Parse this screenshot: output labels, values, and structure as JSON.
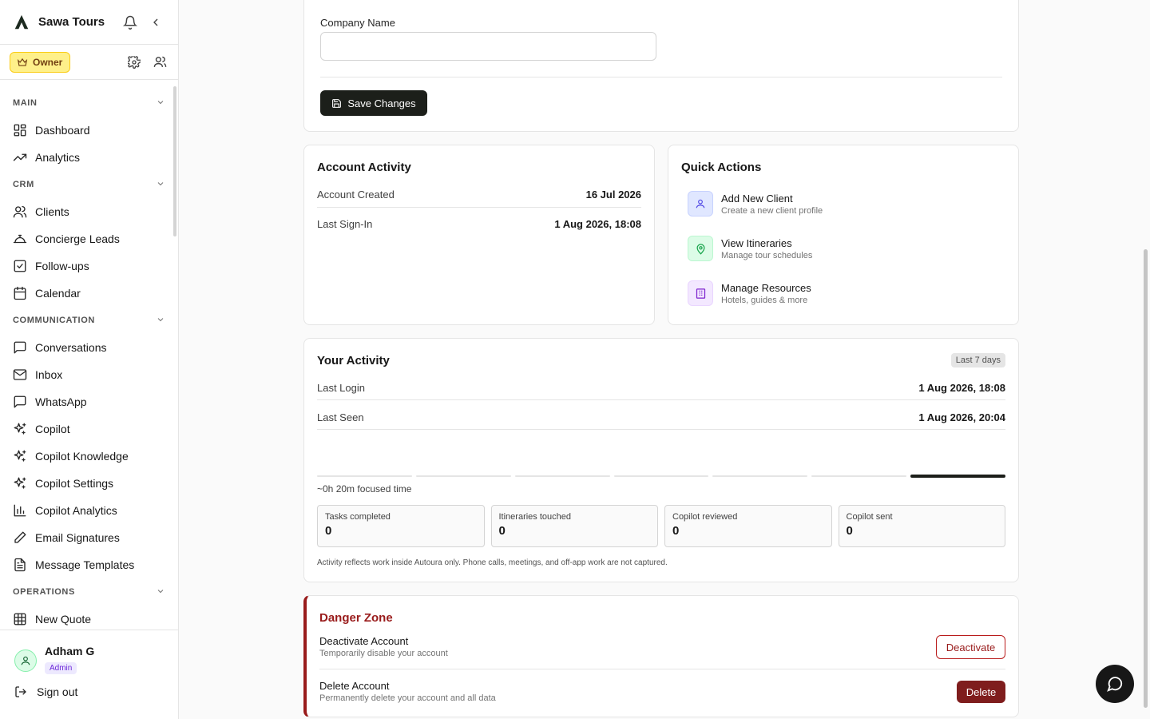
{
  "sidebar": {
    "brand": "Sawa Tours",
    "role": "Owner",
    "sections": [
      {
        "label": "MAIN",
        "items": [
          {
            "label": "Dashboard",
            "icon": "dashboard-icon"
          },
          {
            "label": "Analytics",
            "icon": "trending-up-icon"
          }
        ]
      },
      {
        "label": "CRM",
        "items": [
          {
            "label": "Clients",
            "icon": "users-icon"
          },
          {
            "label": "Concierge Leads",
            "icon": "concierge-bell-icon"
          },
          {
            "label": "Follow-ups",
            "icon": "checkbox-icon"
          },
          {
            "label": "Calendar",
            "icon": "calendar-icon"
          }
        ]
      },
      {
        "label": "COMMUNICATION",
        "items": [
          {
            "label": "Conversations",
            "icon": "message-square-icon"
          },
          {
            "label": "Inbox",
            "icon": "mail-icon"
          },
          {
            "label": "WhatsApp",
            "icon": "message-square-icon"
          },
          {
            "label": "Copilot",
            "icon": "sparkles-icon"
          },
          {
            "label": "Copilot Knowledge",
            "icon": "sparkles-icon"
          },
          {
            "label": "Copilot Settings",
            "icon": "sparkles-icon"
          },
          {
            "label": "Copilot Analytics",
            "icon": "bar-chart-icon"
          },
          {
            "label": "Email Signatures",
            "icon": "pen-icon"
          },
          {
            "label": "Message Templates",
            "icon": "file-text-icon"
          }
        ]
      },
      {
        "label": "OPERATIONS",
        "items": [
          {
            "label": "New Quote",
            "icon": "grid-icon"
          }
        ]
      }
    ],
    "user": {
      "name": "Adham G",
      "badge": "Admin"
    },
    "signout": "Sign out"
  },
  "company": {
    "field_label": "Company Name",
    "field_value": "",
    "save_label": "Save Changes"
  },
  "account_activity": {
    "title": "Account Activity",
    "rows": [
      {
        "label": "Account Created",
        "value": "16 Jul 2026"
      },
      {
        "label": "Last Sign-In",
        "value": "1 Aug 2026, 18:08"
      }
    ]
  },
  "quick_actions": {
    "title": "Quick Actions",
    "items": [
      {
        "title": "Add New Client",
        "subtitle": "Create a new client profile",
        "icon": "user-icon",
        "color": "#e0e7ff",
        "fg": "#4f46e5"
      },
      {
        "title": "View Itineraries",
        "subtitle": "Manage tour schedules",
        "icon": "map-pin-icon",
        "color": "#dcfce7",
        "fg": "#16a34a"
      },
      {
        "title": "Manage Resources",
        "subtitle": "Hotels, guides & more",
        "icon": "building-icon",
        "color": "#f3e8ff",
        "fg": "#7e22ce"
      }
    ]
  },
  "your_activity": {
    "title": "Your Activity",
    "range": "Last 7 days",
    "rows": [
      {
        "label": "Last Login",
        "value": "1 Aug 2026, 18:08"
      },
      {
        "label": "Last Seen",
        "value": "1 Aug 2026, 20:04"
      }
    ],
    "focused": "~0h 20m focused time",
    "active_segments": [
      false,
      false,
      false,
      false,
      false,
      false,
      true
    ],
    "stats": [
      {
        "label": "Tasks completed",
        "value": "0"
      },
      {
        "label": "Itineraries touched",
        "value": "0"
      },
      {
        "label": "Copilot reviewed",
        "value": "0"
      },
      {
        "label": "Copilot sent",
        "value": "0"
      }
    ],
    "note": "Activity reflects work inside Autoura only. Phone calls, meetings, and off-app work are not captured."
  },
  "danger": {
    "title": "Danger Zone",
    "items": [
      {
        "title": "Deactivate Account",
        "subtitle": "Temporarily disable your account",
        "action": "Deactivate"
      },
      {
        "title": "Delete Account",
        "subtitle": "Permanently delete your account and all data",
        "action": "Delete"
      }
    ]
  }
}
